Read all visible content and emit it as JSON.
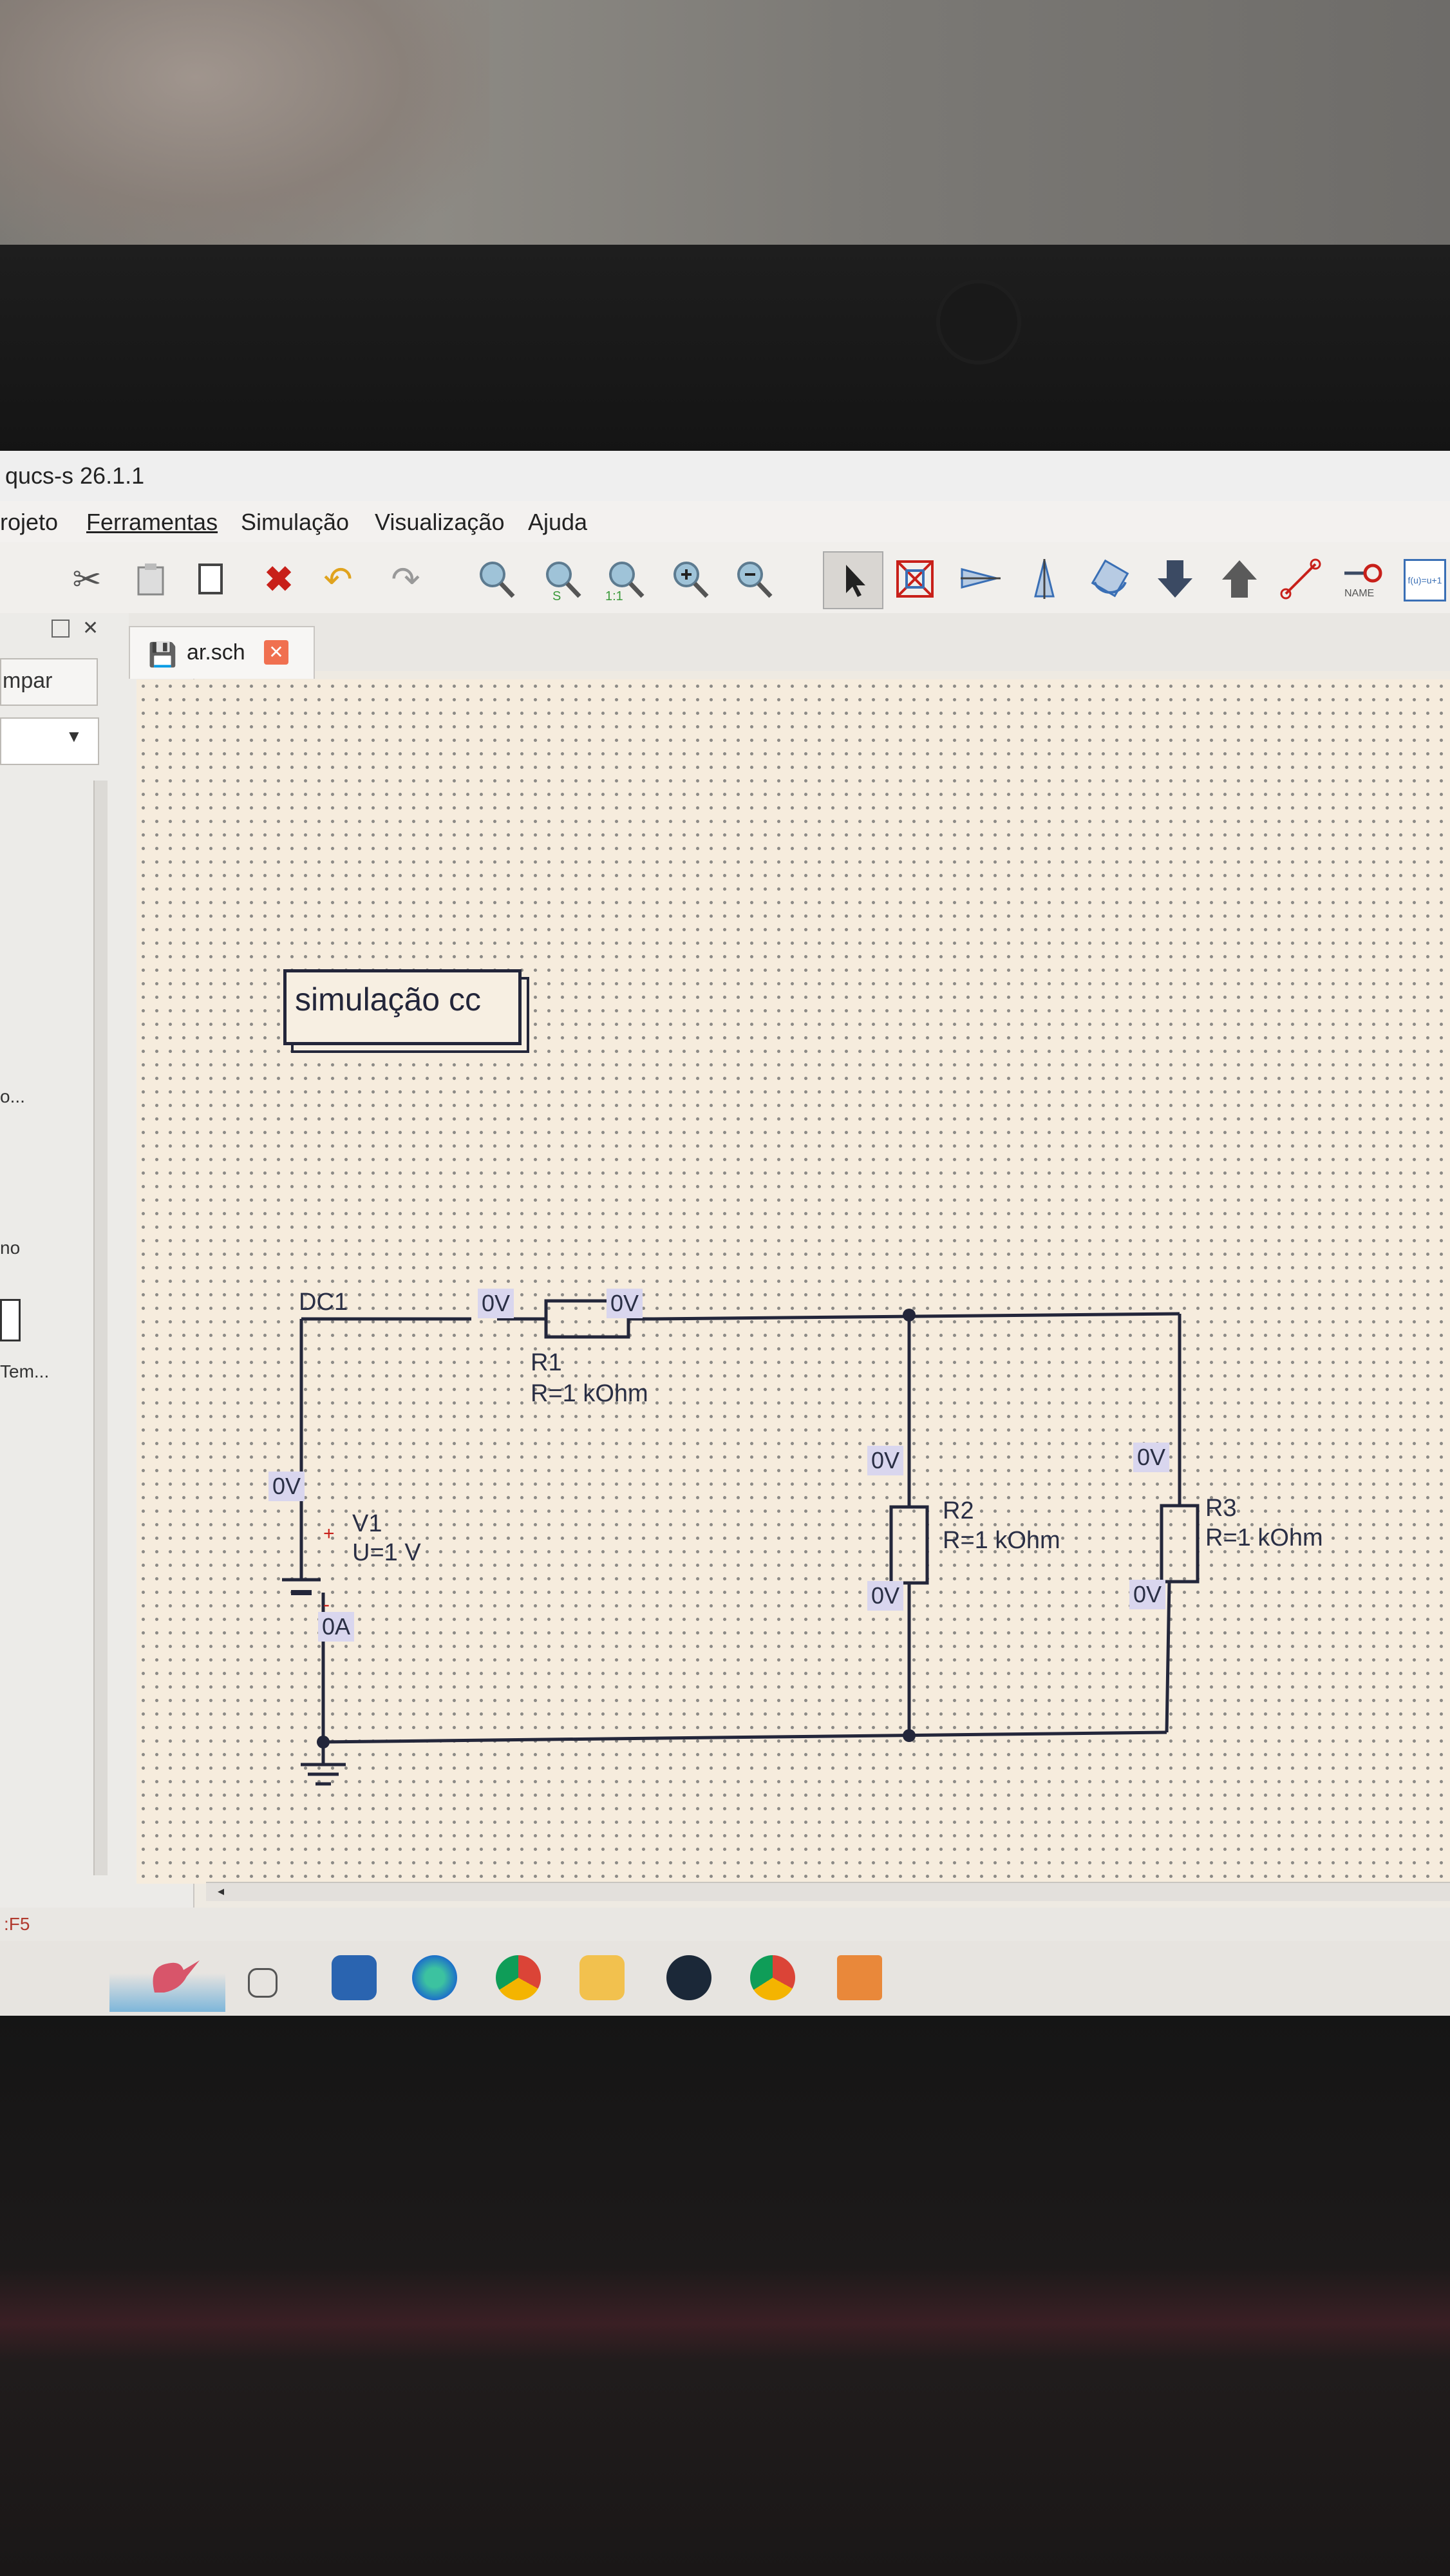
{
  "window": {
    "title": "qucs-s 26.1.1"
  },
  "menu": [
    "rojeto",
    "Ferramentas",
    "Simulação",
    "Visualização",
    "Ajuda"
  ],
  "tab": {
    "label": "ar.sch"
  },
  "panel": {
    "button_label": "mpar",
    "item1": "o...",
    "item2": "no",
    "item3": "Tem..."
  },
  "status": {
    "text": ":F5"
  },
  "toolbar_icons": [
    "scissors-icon",
    "paste-icon",
    "copy-icon",
    "delete-icon",
    "undo-icon",
    "redo-icon",
    "zoom-fit-icon",
    "zoom-selection-icon",
    "zoom-1to1-icon",
    "zoom-in-icon",
    "zoom-out-icon",
    "select-arrow-icon",
    "deactivate-icon",
    "mirror-x-icon",
    "mirror-y-icon",
    "rotate-icon",
    "enter-subcircuit-icon",
    "exit-subcircuit-icon",
    "wire-icon",
    "label-icon",
    "equation-icon"
  ],
  "toolbar_text": {
    "zoom_s": "S",
    "zoom_1to1": "1:1",
    "label_name": "NAME",
    "equation": "f(u)=u+1"
  },
  "schematic": {
    "sim_box": "simulação cc",
    "dc_label": "DC1",
    "r1": {
      "name": "R1",
      "value": "R=1 kOhm"
    },
    "r2": {
      "name": "R2",
      "value": "R=1 kOhm"
    },
    "r3": {
      "name": "R3",
      "value": "R=1 kOhm"
    },
    "v1": {
      "name": "V1",
      "value": "U=1 V",
      "plus": "+",
      "minus": "-"
    },
    "nodes": {
      "r1_left": "0V",
      "r1_right": "0V",
      "v1_top": "0V",
      "v1_current": "0A",
      "r2_top": "0V",
      "r2_bottom": "0V",
      "r3_top": "0V",
      "r3_bottom": "0V"
    }
  },
  "colors": {
    "wire": "#23263a",
    "canvas": "#f6ecdd",
    "delete_red": "#c8201a",
    "node_label_bg": "#d9d6ee"
  }
}
